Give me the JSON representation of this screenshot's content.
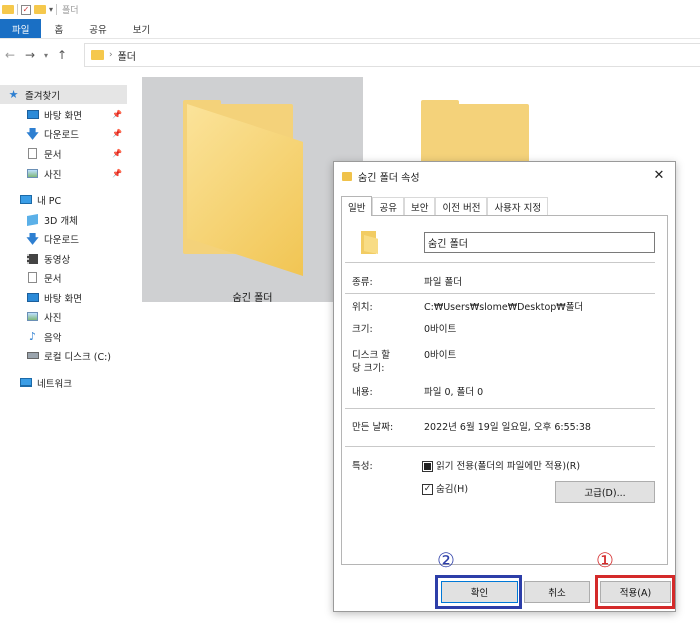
{
  "window": {
    "title": "폴더"
  },
  "ribbon": {
    "tabs": [
      "파일",
      "홈",
      "공유",
      "보기"
    ]
  },
  "address": {
    "path": "폴더"
  },
  "sidebar": {
    "quick_access": {
      "label": "즐겨찾기",
      "items": [
        {
          "label": "바탕 화면",
          "icon": "desktop-icon",
          "pinned": true
        },
        {
          "label": "다운로드",
          "icon": "download-icon",
          "pinned": true
        },
        {
          "label": "문서",
          "icon": "document-icon",
          "pinned": true
        },
        {
          "label": "사진",
          "icon": "pictures-icon",
          "pinned": true
        }
      ]
    },
    "this_pc": {
      "label": "내 PC",
      "items": [
        {
          "label": "3D 개체",
          "icon": "3d-objects-icon"
        },
        {
          "label": "다운로드",
          "icon": "download-icon"
        },
        {
          "label": "동영상",
          "icon": "video-icon"
        },
        {
          "label": "문서",
          "icon": "document-icon"
        },
        {
          "label": "바탕 화면",
          "icon": "desktop-icon"
        },
        {
          "label": "사진",
          "icon": "pictures-icon"
        },
        {
          "label": "음악",
          "icon": "music-icon"
        },
        {
          "label": "로컬 디스크 (C:)",
          "icon": "drive-icon"
        }
      ]
    },
    "network": {
      "label": "네트워크"
    }
  },
  "content": {
    "folders": [
      {
        "name": "숨긴 폴더",
        "selected": true
      }
    ]
  },
  "dialog": {
    "title": "숨긴 폴더 속성",
    "tabs": [
      "일반",
      "공유",
      "보안",
      "이전 버전",
      "사용자 지정"
    ],
    "active_tab": "일반",
    "name_value": "숨긴 폴더",
    "props": {
      "type_label": "종류:",
      "type_value": "파일 폴더",
      "location_label": "위치:",
      "location_value": "C:₩Users₩slome₩Desktop₩폴더",
      "size_label": "크기:",
      "size_value": "0바이트",
      "disk_size_label_1": "디스크 할",
      "disk_size_label_2": "당 크기:",
      "disk_size_value": "0바이트",
      "contains_label": "내용:",
      "contains_value": "파일 0, 폴더 0",
      "created_label": "만든 날짜:",
      "created_value": "2022년 6월 19일 일요일, 오후 6:55:38",
      "attributes_label": "특성:",
      "readonly_label": "읽기 전용(폴더의 파일에만 적용)(R)",
      "hidden_label": "숨김(H)",
      "advanced_button": "고급(D)...",
      "readonly_state": "indeterminate",
      "hidden_checked": true
    },
    "buttons": {
      "ok": "확인",
      "cancel": "취소",
      "apply": "적용(A)"
    }
  },
  "annotations": {
    "badge_1": "①",
    "badge_2": "②",
    "color_1": "#d42a2a",
    "color_2": "#2d3ea8"
  }
}
